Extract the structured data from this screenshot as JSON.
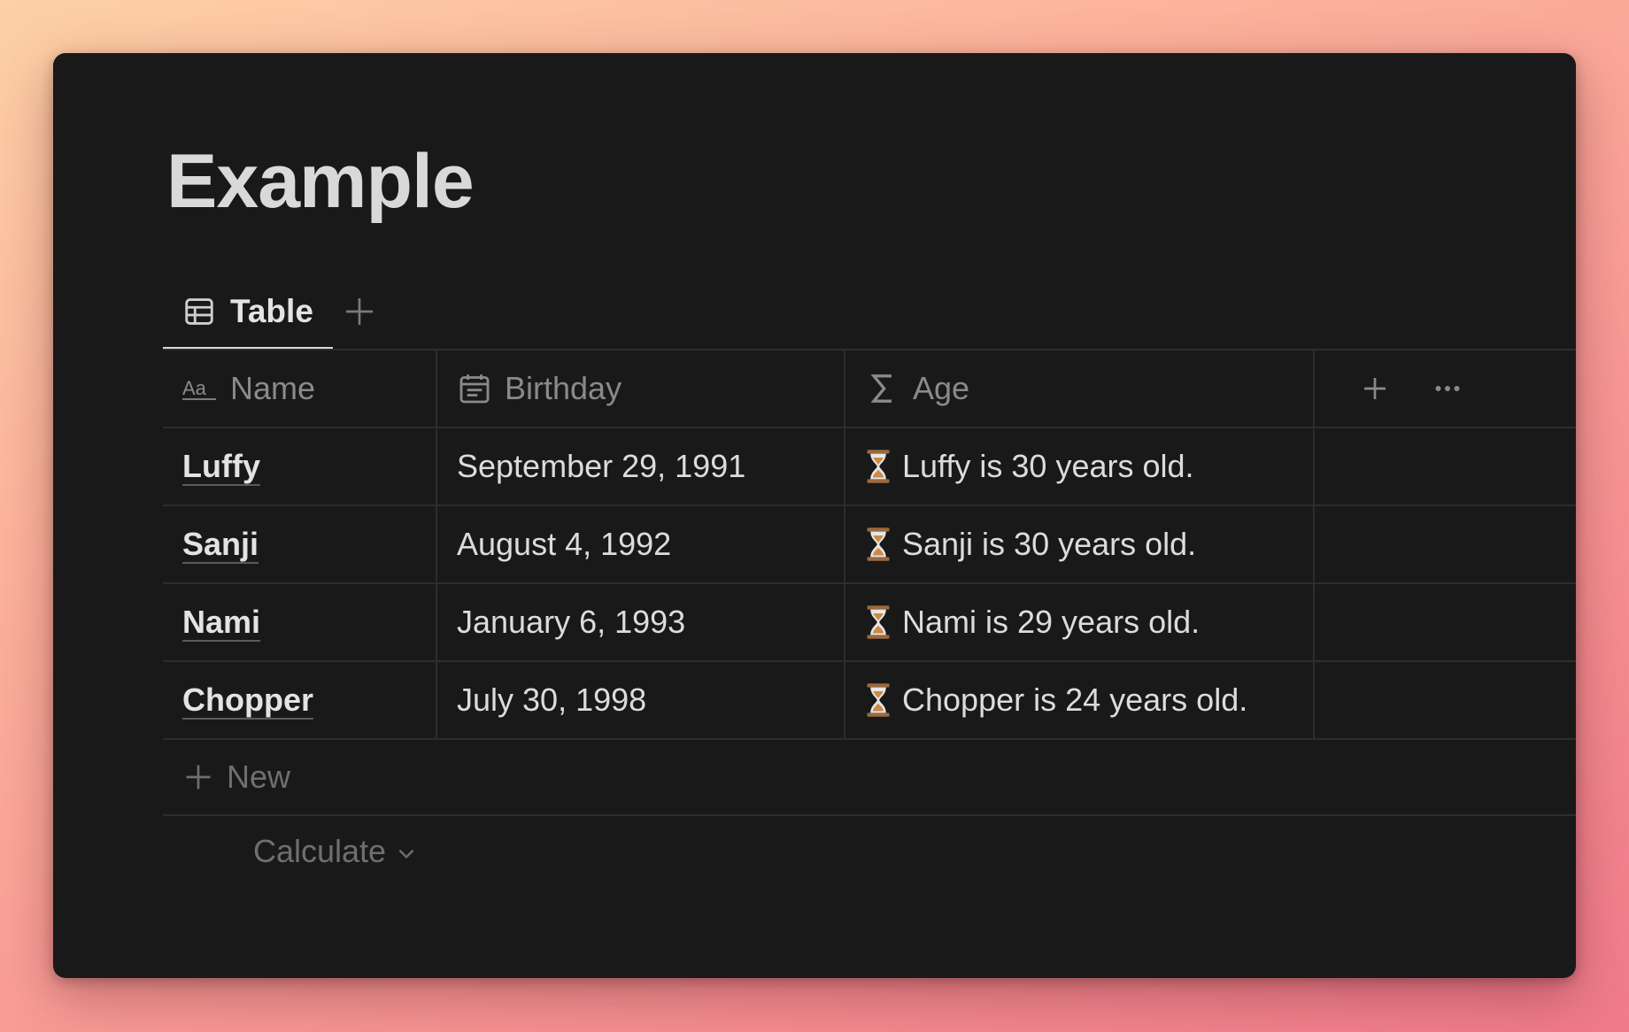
{
  "page": {
    "title": "Example"
  },
  "tabs": [
    {
      "label": "Table",
      "icon": "table-icon",
      "active": true
    }
  ],
  "table": {
    "columns": [
      {
        "label": "Name",
        "icon": "text-property-icon"
      },
      {
        "label": "Birthday",
        "icon": "calendar-icon"
      },
      {
        "label": "Age",
        "icon": "formula-sigma-icon"
      }
    ],
    "rows": [
      {
        "name": "Luffy",
        "birthday": "September 29, 1991",
        "age_emoji": "hourglass-icon",
        "age": "Luffy is 30 years old."
      },
      {
        "name": "Sanji",
        "birthday": "August 4, 1992",
        "age_emoji": "hourglass-icon",
        "age": "Sanji is 30 years old."
      },
      {
        "name": "Nami",
        "birthday": "January 6, 1993",
        "age_emoji": "hourglass-icon",
        "age": "Nami is 29 years old."
      },
      {
        "name": "Chopper",
        "birthday": "July 30, 1998",
        "age_emoji": "hourglass-icon",
        "age": "Chopper is 24 years old."
      }
    ],
    "new_label": "New",
    "calculate_label": "Calculate"
  },
  "colors": {
    "window_bg": "#191919",
    "text_primary": "#e3e3e3",
    "text_muted": "#8a8a8a",
    "divider": "#2d2d2d"
  }
}
